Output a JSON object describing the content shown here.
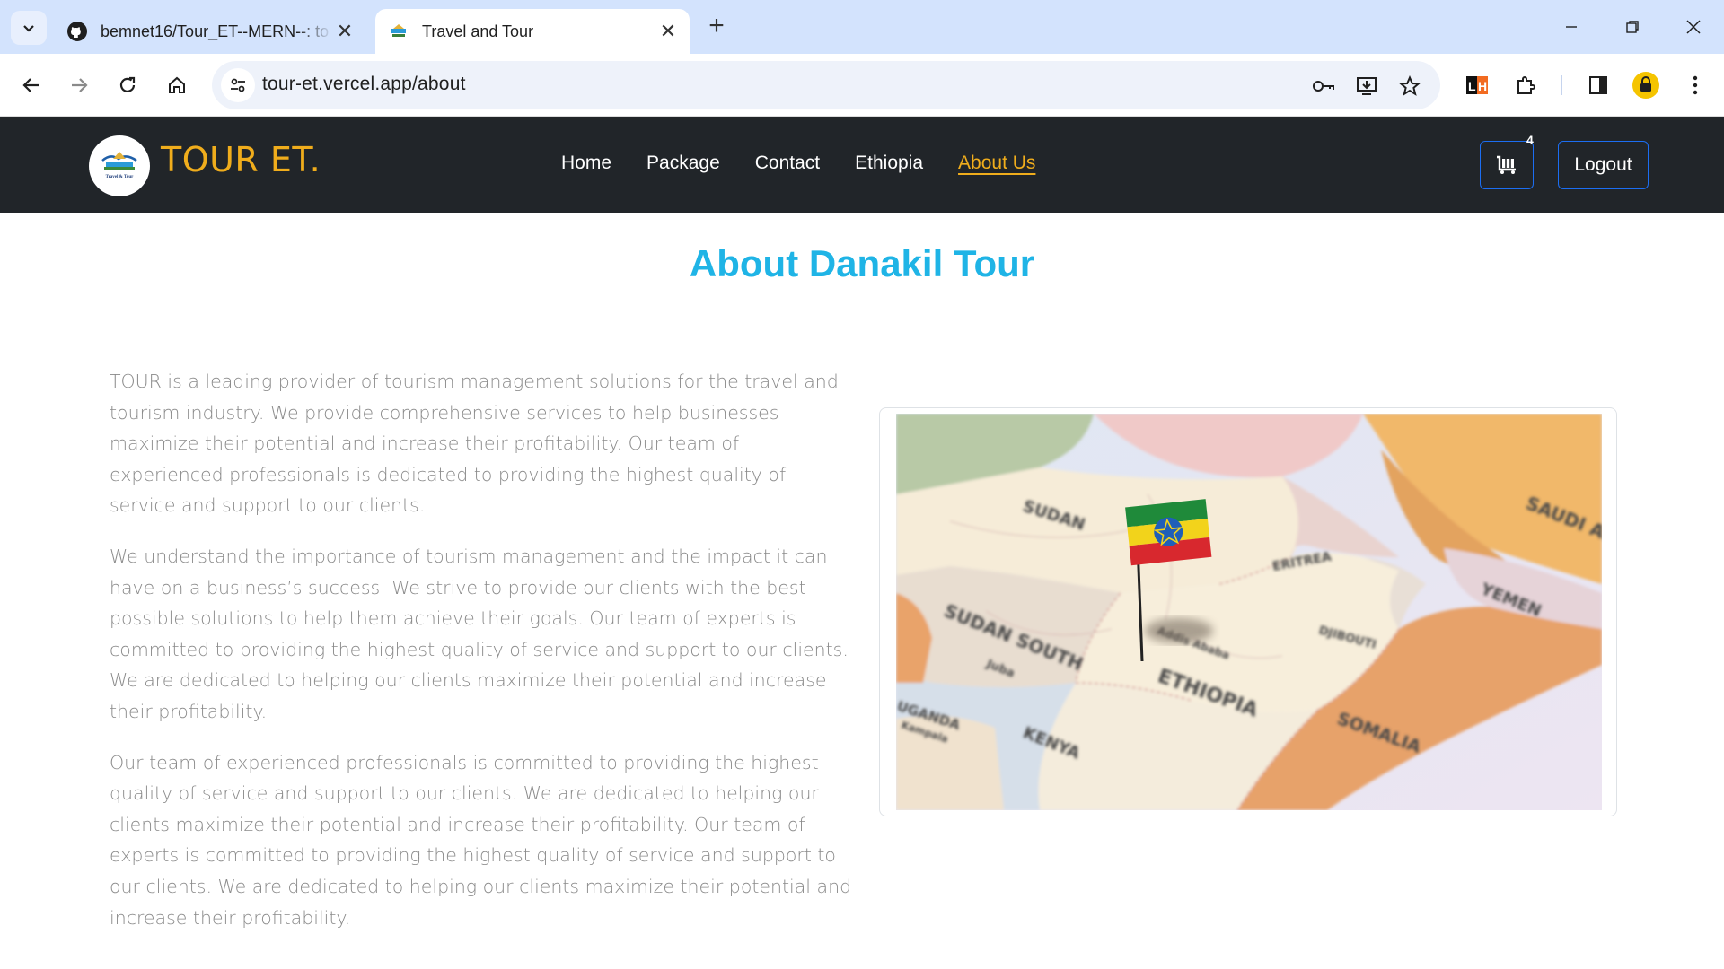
{
  "browser": {
    "tabs": [
      {
        "title": "bemnet16/Tour_ET--MERN--: to",
        "favicon": "github-icon",
        "active": false
      },
      {
        "title": "Travel and Tour",
        "favicon": "site-favicon",
        "active": true
      }
    ],
    "url": "tour-et.vercel.app/about"
  },
  "site": {
    "brand": "TOUR ET.",
    "logo_caption": "Travel & Tour",
    "nav": [
      "Home",
      "Package",
      "Contact",
      "Ethiopia",
      "About Us"
    ],
    "active_nav": "About Us",
    "cart_count": "4",
    "logout_label": "Logout",
    "accent_color": "#f0ad1c"
  },
  "main": {
    "heading": "About Danakil Tour",
    "paragraphs": [
      "TOUR is a leading provider of tourism management solutions for the travel and tourism industry. We provide comprehensive services to help businesses maximize their potential and increase their profitability. Our team of experienced professionals is dedicated to providing the highest quality of service and support to our clients.",
      "We understand the importance of tourism management and the impact it can have on a business’s success. We strive to provide our clients with the best possible solutions to help them achieve their goals. Our team of experts is committed to providing the highest quality of service and support to our clients. We are dedicated to helping our clients maximize their potential and increase their profitability.",
      "Our team of experienced professionals is committed to providing the highest quality of service and support to our clients. We are dedicated to helping our clients maximize their potential and increase their profitability. Our team of experts is committed to providing the highest quality of service and support to our clients. We are dedicated to helping our clients maximize their potential and increase their profitability."
    ],
    "map_labels": [
      "SUDAN",
      "SAUDI ARABIA",
      "YEMEN",
      "ERITREA",
      "DJIBOUTI",
      "SUDAN SOUTH",
      "Juba",
      "ETHIOPIA",
      "Addis Ababa",
      "UGANDA",
      "Kampala",
      "KENYA",
      "SOMALIA"
    ]
  }
}
